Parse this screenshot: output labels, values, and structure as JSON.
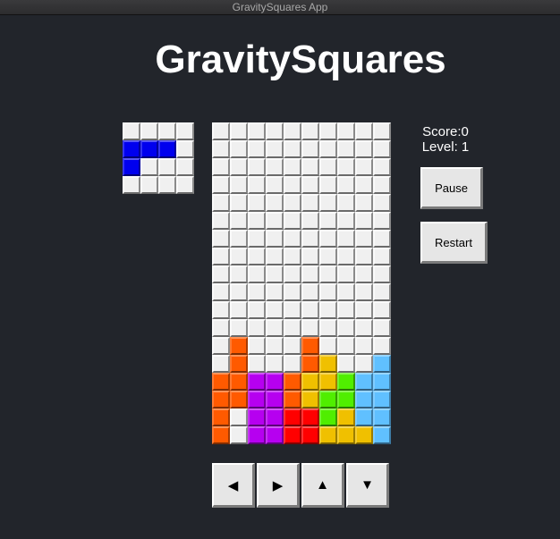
{
  "window": {
    "title": "GravitySquares App"
  },
  "header": {
    "title": "GravitySquares"
  },
  "stats": {
    "score": "Score:0",
    "level": "Level: 1"
  },
  "buttons": {
    "pause": "Pause",
    "restart": "Restart"
  },
  "controls": {
    "left": "◀",
    "right": "▶",
    "up": "▲",
    "down": "▼"
  },
  "colors": {
    "E": "#f0f0f0",
    "B": "#0000ee",
    "O": "#ff5a00",
    "P": "#b600f0",
    "R": "#ff0000",
    "Y": "#f0c000",
    "G": "#50ee00",
    "L": "#60c0ff"
  },
  "preview": {
    "rows": [
      "....",
      "BBB.",
      "B...",
      "...."
    ]
  },
  "board": {
    "rows": [
      "..........",
      "..........",
      "..........",
      "..........",
      "..........",
      "..........",
      "..........",
      "..........",
      "..........",
      "..........",
      "..........",
      "..........",
      ".O...O....",
      ".O...OY..L",
      "OOPPOYYGLL",
      "OOPPOYGGLL",
      "O.PPRRGYLL",
      "O.PPRRYYYL"
    ]
  }
}
